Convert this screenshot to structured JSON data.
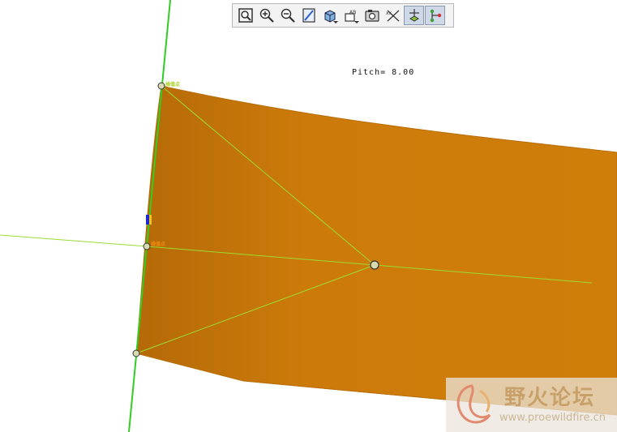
{
  "toolbar": {
    "buttons": [
      {
        "name": "refit-icon",
        "active": false
      },
      {
        "name": "zoom-in-icon",
        "active": false
      },
      {
        "name": "zoom-out-icon",
        "active": false
      },
      {
        "name": "repaint-icon",
        "active": false
      },
      {
        "name": "display-style-icon",
        "active": false,
        "dropdown": true
      },
      {
        "name": "saved-views-icon",
        "active": false,
        "dropdown": true
      },
      {
        "name": "view-manager-icon",
        "active": false
      },
      {
        "name": "datum-axes-toggle-icon",
        "active": false
      },
      {
        "name": "datum-planes-toggle-icon",
        "active": true
      },
      {
        "name": "datum-points-toggle-icon",
        "active": true
      }
    ]
  },
  "annotation": {
    "pitch_label": "Pitch= 8.00"
  },
  "vertex_tags": {
    "top": "插值点",
    "middle": "插值点"
  },
  "colors": {
    "surface": "#cd7a0a",
    "datum_line": "#99dd33",
    "axis_green": "#33cc22",
    "background": "#ffffff"
  },
  "watermark": {
    "title": "野火论坛",
    "url": "www.proewildfire.cn"
  }
}
